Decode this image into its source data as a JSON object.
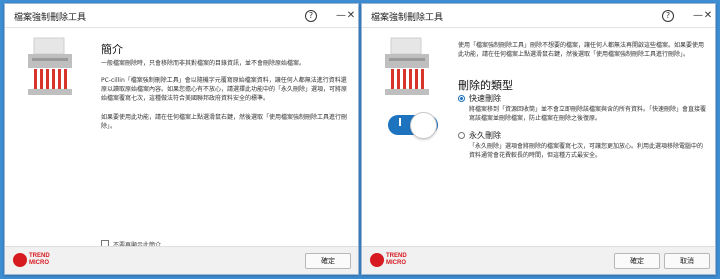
{
  "left_window": {
    "title": "檔案強制刪除工具",
    "heading": "簡介",
    "para1": "一般檔案刪除時，只會移除而非其對檔案的目錄資訊，並不會刪除原始檔案。",
    "para2": "PC-cillin「檔案強制刪除工具」會以隨機字元覆寫原始檔案資料，讓任何人都無法進行資料還原以讀取原始檔案內容。如果您擔心有不放心，請選擇此功能中的「永久刪除」選項，可將原始檔案覆寫七次，這種做法符合美國聯邦政府資料安全的標準。",
    "para3": "如果要使用此功能，請在任何檔案上點選滑鼠右鍵，然後選取「使用檔案強制刪除工具進行刪除」。",
    "checkbox_label": "不要再顯示此簡介",
    "checkbox_checked": false,
    "ok_button": "確定"
  },
  "right_window": {
    "title": "檔案強制刪除工具",
    "intro": "使用「檔案強制刪除工具」刪除不想要的檔案，讓任何人都無法再開啟這些檔案。如果要使用此功能，請在任何檔案上點選滑鼠右鍵，然後選取「使用檔案強制刪除工具進行刪除」。",
    "section_heading": "刪除的類型",
    "option1_label": "快速刪除",
    "option1_desc": "將檔案移到「資源回收筒」並不會立即刪除該檔案與含的所有資料。「快速刪除」會直接覆寫該檔案並刪除檔案，防止檔案在刪除之後復原。",
    "option1_selected": true,
    "option2_label": "永久刪除",
    "option2_desc": "「永久刪除」選項會將刪除的檔案覆寫七次，可讓您更加放心。利用此選項移除電腦中的資料通常會花費較長的時間，但這種方式最安全。",
    "option2_selected": false,
    "toggle_on": true,
    "ok_button": "確定",
    "cancel_button": "取消"
  },
  "common": {
    "help_symbol": "?",
    "close_symbol": "✕",
    "logo_line1": "TREND",
    "logo_line2": "MICRO",
    "accent_color": "#1e73be",
    "brand_color": "#d71920"
  }
}
